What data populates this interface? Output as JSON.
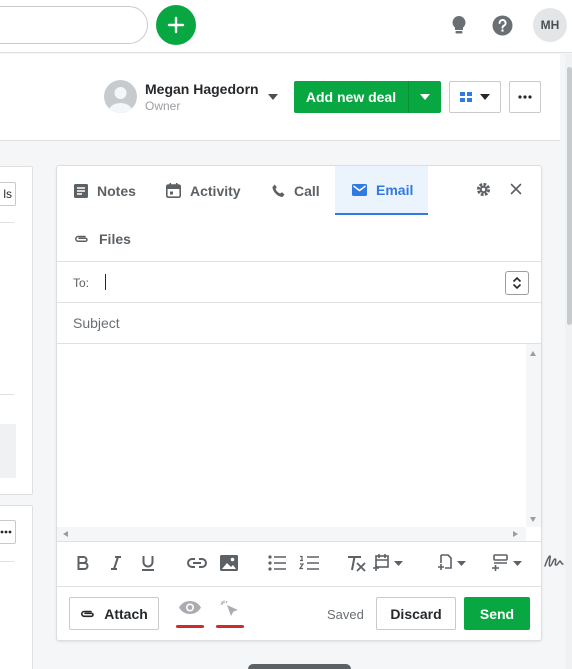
{
  "topbar": {
    "user_initials": "MH",
    "icons": [
      "plus-icon",
      "lightbulb-icon",
      "help-icon"
    ]
  },
  "header": {
    "owner_name": "Megan Hagedorn",
    "owner_role": "Owner",
    "add_deal_label": "Add new deal"
  },
  "left": {
    "button1_text": "ls"
  },
  "email_panel": {
    "tabs": [
      {
        "label": "Notes",
        "icon": "notes-icon"
      },
      {
        "label": "Activity",
        "icon": "calendar-icon"
      },
      {
        "label": "Call",
        "icon": "phone-icon"
      },
      {
        "label": "Email",
        "icon": "envelope-icon",
        "active": true
      },
      {
        "label": "Files",
        "icon": "paperclip-icon"
      }
    ],
    "to_label": "To:",
    "to_value": "",
    "subject_placeholder": "Subject",
    "attach_label": "Attach",
    "saved_label": "Saved",
    "discard_label": "Discard",
    "send_label": "Send"
  },
  "colors": {
    "brand_green": "#08a742",
    "active_blue": "#317ae2",
    "active_tab_bg": "#ebf3fc",
    "tracking_underline": "#d02a2a"
  }
}
